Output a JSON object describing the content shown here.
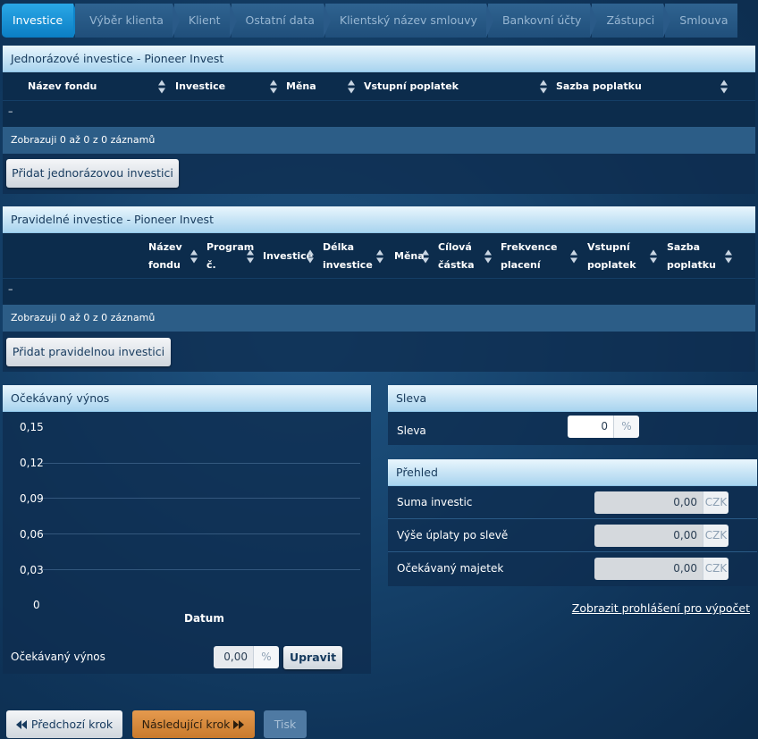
{
  "tabs": [
    "Investice",
    "Výběr klienta",
    "Klient",
    "Ostatní data",
    "Klientský název smlouvy",
    "Bankovní účty",
    "Zástupci",
    "Smlouva"
  ],
  "one_time": {
    "title": "Jednorázové investice - Pioneer Invest",
    "columns": [
      "Název fondu",
      "Investice",
      "Měna",
      "Vstupní poplatek",
      "Sazba poplatku"
    ],
    "empty_row": "–",
    "info": "Zobrazuji 0 až 0 z 0 záznamů",
    "add_button": "Přidat jednorázovou investici"
  },
  "regular": {
    "title": "Pravidelné investice - Pioneer Invest",
    "columns": [
      [
        "Název",
        "fondu"
      ],
      [
        "Program",
        "č."
      ],
      [
        "Investice"
      ],
      [
        "Délka",
        "investice"
      ],
      [
        "Měna"
      ],
      [
        "Cílová",
        "částka"
      ],
      [
        "Frekvence",
        "placení"
      ],
      [
        "Vstupní",
        "poplatek"
      ],
      [
        "Sazba",
        "poplatku"
      ]
    ],
    "empty_row": "–",
    "info": "Zobrazuji 0 až 0 z 0 záznamů",
    "add_button": "Přidat pravidelnou investici"
  },
  "expected_yield": {
    "title": "Očekávaný výnos",
    "label": "Očekávaný výnos",
    "value": "0,00",
    "unit": "%",
    "update_button": "Upravit"
  },
  "chart_data": {
    "type": "line",
    "xlabel": "Datum",
    "ylabel": "",
    "y_ticks": [
      "0,15",
      "0,12",
      "0,09",
      "0,06",
      "0,03",
      "0"
    ],
    "ylim": [
      0,
      0.15
    ],
    "grid": true,
    "series": []
  },
  "discount": {
    "title": "Sleva",
    "label": "Sleva",
    "value": "0",
    "unit": "%"
  },
  "overview": {
    "title": "Přehled",
    "rows": [
      {
        "label": "Suma investic",
        "value": "0,00",
        "unit": "CZK"
      },
      {
        "label": "Výše úplaty po slevě",
        "value": "0,00",
        "unit": "CZK"
      },
      {
        "label": "Očekávaný majetek",
        "value": "0,00",
        "unit": "CZK"
      }
    ]
  },
  "disclaimer_link": "Zobrazit prohlášení pro výpočet",
  "footer": {
    "prev": "Předchozí krok",
    "next": "Následující krok",
    "print": "Tisk"
  },
  "colors": {
    "accent": "#0f84c9",
    "next_button": "#d98a3d",
    "header_light": "#c5e3f5"
  }
}
